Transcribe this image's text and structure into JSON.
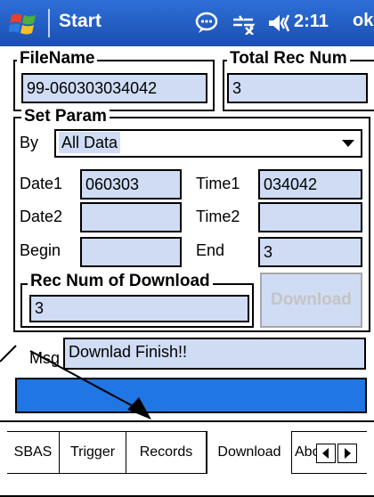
{
  "titlebar": {
    "title": "Start",
    "time": "2:11",
    "ok_label": "ok",
    "icons": [
      "windows-flag-icon",
      "chat-icon",
      "connectivity-icon",
      "volume-icon"
    ]
  },
  "filename": {
    "label": "FileName",
    "value": "99-060303034042"
  },
  "total_rec": {
    "label": "Total Rec Num",
    "value": "3"
  },
  "set_param": {
    "label": "Set Param",
    "by_label": "By",
    "by_value": "All Data",
    "date1_label": "Date1",
    "date1_value": "060303",
    "time1_label": "Time1",
    "time1_value": "034042",
    "date2_label": "Date2",
    "date2_value": "",
    "time2_label": "Time2",
    "time2_value": "",
    "begin_label": "Begin",
    "begin_value": "",
    "end_label": "End",
    "end_value": "3"
  },
  "rec_download": {
    "label": "Rec Num of Download",
    "value": "3",
    "button_label": "Download"
  },
  "msg": {
    "label": "Msg",
    "value": "Downlad Finish!!"
  },
  "progress": {
    "fraction": 1.0,
    "color": "#1f76e4"
  },
  "tabs": [
    "SBAS",
    "Trigger",
    "Records",
    "Download",
    "Abo"
  ],
  "active_tab": "Download",
  "colors": {
    "titlebar": "#1b4fb1",
    "field_bg": "#cfdcf4",
    "disabled_text": "#c8c8c8"
  }
}
